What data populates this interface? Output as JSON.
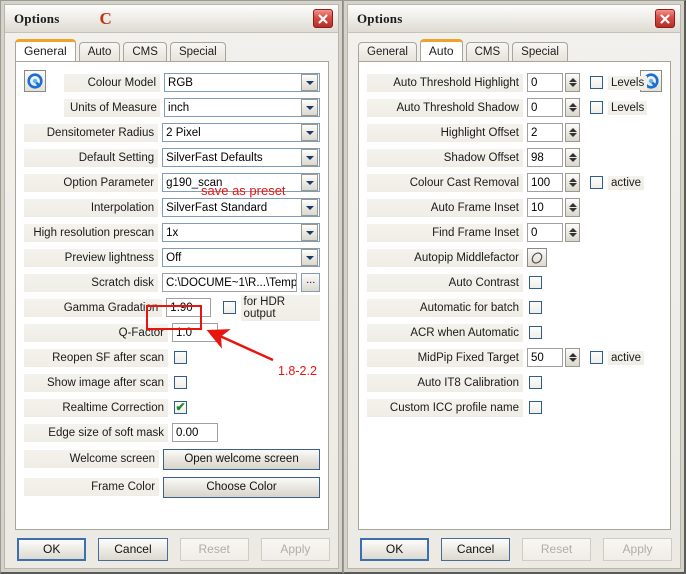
{
  "left_window": {
    "title": "Options",
    "title_annotation": "C",
    "close_icon": "close-icon",
    "tabs": [
      {
        "label": "General",
        "active": true
      },
      {
        "label": "Auto",
        "active": false
      },
      {
        "label": "CMS",
        "active": false
      },
      {
        "label": "Special",
        "active": false
      }
    ],
    "rows": [
      {
        "label": "Colour Model",
        "value": "RGB",
        "type": "combo"
      },
      {
        "label": "Units of Measure",
        "value": "inch",
        "type": "combo"
      },
      {
        "label": "Densitometer Radius",
        "value": "2 Pixel",
        "type": "combo"
      },
      {
        "label": "Default Setting",
        "value": "SilverFast Defaults",
        "type": "combo"
      },
      {
        "label": "Option Parameter",
        "value": "g190_scan",
        "type": "combo"
      },
      {
        "label": "Interpolation",
        "value": "SilverFast Standard",
        "type": "combo"
      },
      {
        "label": "High resolution prescan",
        "value": "1x",
        "type": "combo"
      },
      {
        "label": "Preview lightness",
        "value": "Off",
        "type": "combo"
      },
      {
        "label": "Scratch disk",
        "value": "C:\\DOCUME~1\\R...\\Temp\\",
        "type": "path",
        "browse_label": "..."
      },
      {
        "label": "Gamma Gradation",
        "value": "1.90",
        "type": "text_check",
        "check_label": "for HDR output",
        "checked": false
      },
      {
        "label": "Q-Factor",
        "value": "1.0",
        "type": "text"
      },
      {
        "label": "Reopen SF after scan",
        "value": "",
        "type": "check",
        "checked": false
      },
      {
        "label": "Show image after scan",
        "value": "",
        "type": "check",
        "checked": false
      },
      {
        "label": "Realtime Correction",
        "value": "",
        "type": "check",
        "checked": true
      },
      {
        "label": "Edge size of soft mask",
        "value": "0.00",
        "type": "text"
      },
      {
        "label": "Welcome screen",
        "value": "Open welcome screen",
        "type": "button"
      },
      {
        "label": "Frame Color",
        "value": "Choose Color",
        "type": "button"
      }
    ],
    "annotations": {
      "save_as_preset": "save as preset",
      "gamma_range": "1.8-2.2"
    },
    "footer": [
      {
        "label": "OK",
        "state": "default"
      },
      {
        "label": "Cancel",
        "state": "normal"
      },
      {
        "label": "Reset",
        "state": "disabled"
      },
      {
        "label": "Apply",
        "state": "disabled"
      }
    ]
  },
  "right_window": {
    "title": "Options",
    "close_icon": "close-icon",
    "tabs": [
      {
        "label": "General",
        "active": false
      },
      {
        "label": "Auto",
        "active": true
      },
      {
        "label": "CMS",
        "active": false
      },
      {
        "label": "Special",
        "active": false
      }
    ],
    "rows": [
      {
        "label": "Auto Threshold Highlight",
        "value": "0",
        "type": "spin_check",
        "check_label": "Levels",
        "checked": false
      },
      {
        "label": "Auto Threshold Shadow",
        "value": "0",
        "type": "spin_check",
        "check_label": "Levels",
        "checked": false
      },
      {
        "label": "Highlight Offset",
        "value": "2",
        "type": "spin"
      },
      {
        "label": "Shadow Offset",
        "value": "98",
        "type": "spin"
      },
      {
        "label": "Colour Cast Removal",
        "value": "100",
        "type": "spin_check",
        "check_label": "active",
        "checked": false
      },
      {
        "label": "Auto Frame Inset",
        "value": "10",
        "type": "spin"
      },
      {
        "label": "Find Frame Inset",
        "value": "0",
        "type": "spin"
      },
      {
        "label": "Autopip Middlefactor",
        "value": "",
        "type": "iconbtn"
      },
      {
        "label": "Auto Contrast",
        "value": "",
        "type": "check",
        "checked": false
      },
      {
        "label": "Automatic for batch",
        "value": "",
        "type": "check",
        "checked": false
      },
      {
        "label": "ACR when Automatic",
        "value": "",
        "type": "check",
        "checked": false
      },
      {
        "label": "MidPip Fixed Target",
        "value": "50",
        "type": "spin_check",
        "check_label": "active",
        "checked": false
      },
      {
        "label": "Auto IT8 Calibration",
        "value": "",
        "type": "check",
        "checked": false
      },
      {
        "label": "Custom ICC profile name",
        "value": "",
        "type": "check",
        "checked": false
      }
    ],
    "footer": [
      {
        "label": "OK",
        "state": "default"
      },
      {
        "label": "Cancel",
        "state": "normal"
      },
      {
        "label": "Reset",
        "state": "disabled"
      },
      {
        "label": "Apply",
        "state": "disabled"
      }
    ]
  },
  "colors": {
    "accent_tab": "#f0a32a",
    "annotation_red": "#e8150f",
    "title_annotation": "#c1380f",
    "close_red": "#b62d27"
  }
}
